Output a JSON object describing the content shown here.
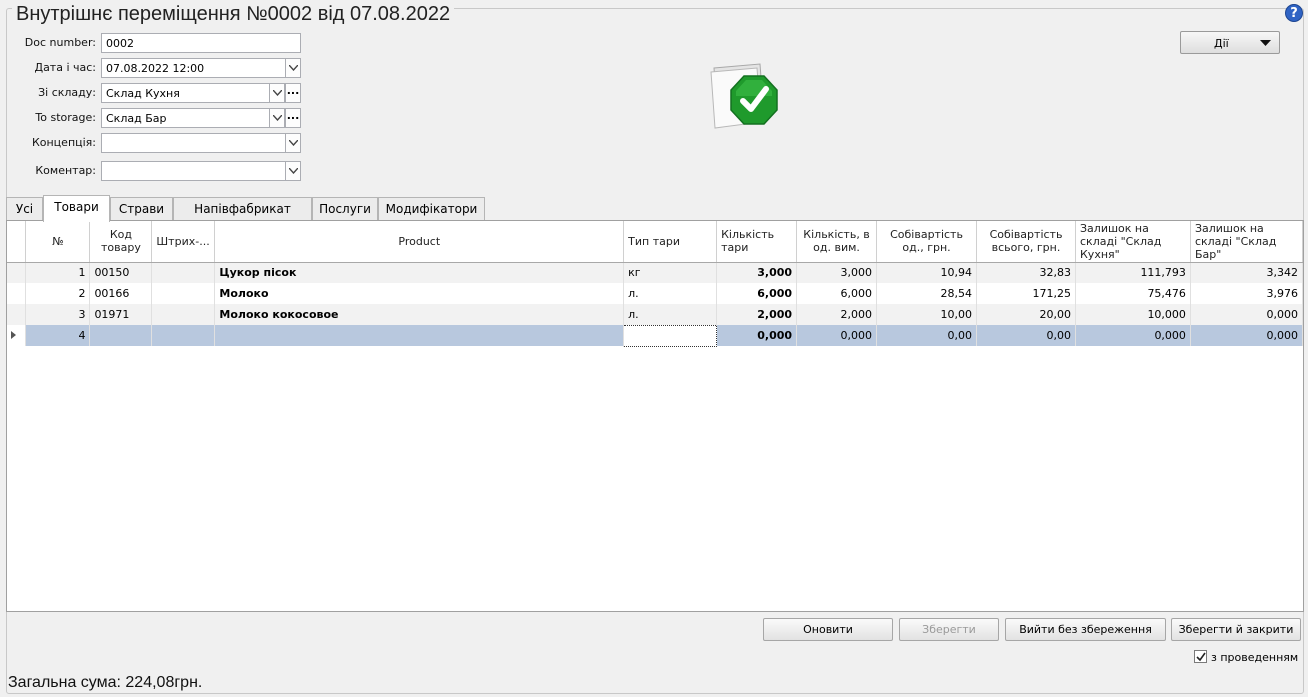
{
  "window": {
    "title": "Внутрішнє переміщення №0002 від 07.08.2022",
    "help_glyph": "?"
  },
  "form": {
    "doc_number": {
      "label": "Doc number:",
      "value": "0002"
    },
    "datetime": {
      "label": "Дата і час:",
      "value": "07.08.2022 12:00"
    },
    "from_storage": {
      "label": "Зі складу:",
      "value": "Склад Кухня"
    },
    "to_storage": {
      "label": "To storage:",
      "value": "Склад Бар"
    },
    "concept": {
      "label": "Концепція:",
      "value": ""
    },
    "comment": {
      "label": "Коментар:",
      "value": ""
    }
  },
  "actions_button": {
    "label": "Дії"
  },
  "status": {
    "icon": "document-processed-checkmark-icon",
    "color": "#1f9a2c"
  },
  "tabs": [
    {
      "label": "Усі"
    },
    {
      "label": "Товари",
      "active": true
    },
    {
      "label": "Страви"
    },
    {
      "label": "Напівфабрикат"
    },
    {
      "label": "Послуги"
    },
    {
      "label": "Модифікатори"
    }
  ],
  "table": {
    "columns": [
      "№",
      "Код товару",
      "Штрих-...",
      "Product",
      "Тип тари",
      "Кількість тари",
      "Кількість, в од. вим.",
      "Собівартість од., грн.",
      "Собівартість всього, грн.",
      "Залишок на складі \"Склад Кухня\"",
      "Залишок на складі \"Склад Бар\""
    ],
    "rows": [
      [
        "1",
        "00150",
        "",
        "Цукор пісок",
        "кг",
        "3,000",
        "3,000",
        "10,94",
        "32,83",
        "111,793",
        "3,342"
      ],
      [
        "2",
        "00166",
        "",
        "Молоко",
        "л.",
        "6,000",
        "6,000",
        "28,54",
        "171,25",
        "75,476",
        "3,976"
      ],
      [
        "3",
        "01971",
        "",
        "Молоко кокосовое",
        "л.",
        "2,000",
        "2,000",
        "10,00",
        "20,00",
        "10,000",
        "0,000"
      ],
      [
        "4",
        "",
        "",
        "",
        "",
        "0,000",
        "0,000",
        "0,00",
        "0,00",
        "0,000",
        "0,000"
      ]
    ]
  },
  "buttons": {
    "refresh": "Оновити",
    "save": "Зберегти",
    "exit_no_save": "Вийти без збереження",
    "save_close": "Зберегти й закрити"
  },
  "with_posting": {
    "label": "з проведенням",
    "checked": true
  },
  "total": {
    "text": "Загальна сума: 224,08грн."
  }
}
